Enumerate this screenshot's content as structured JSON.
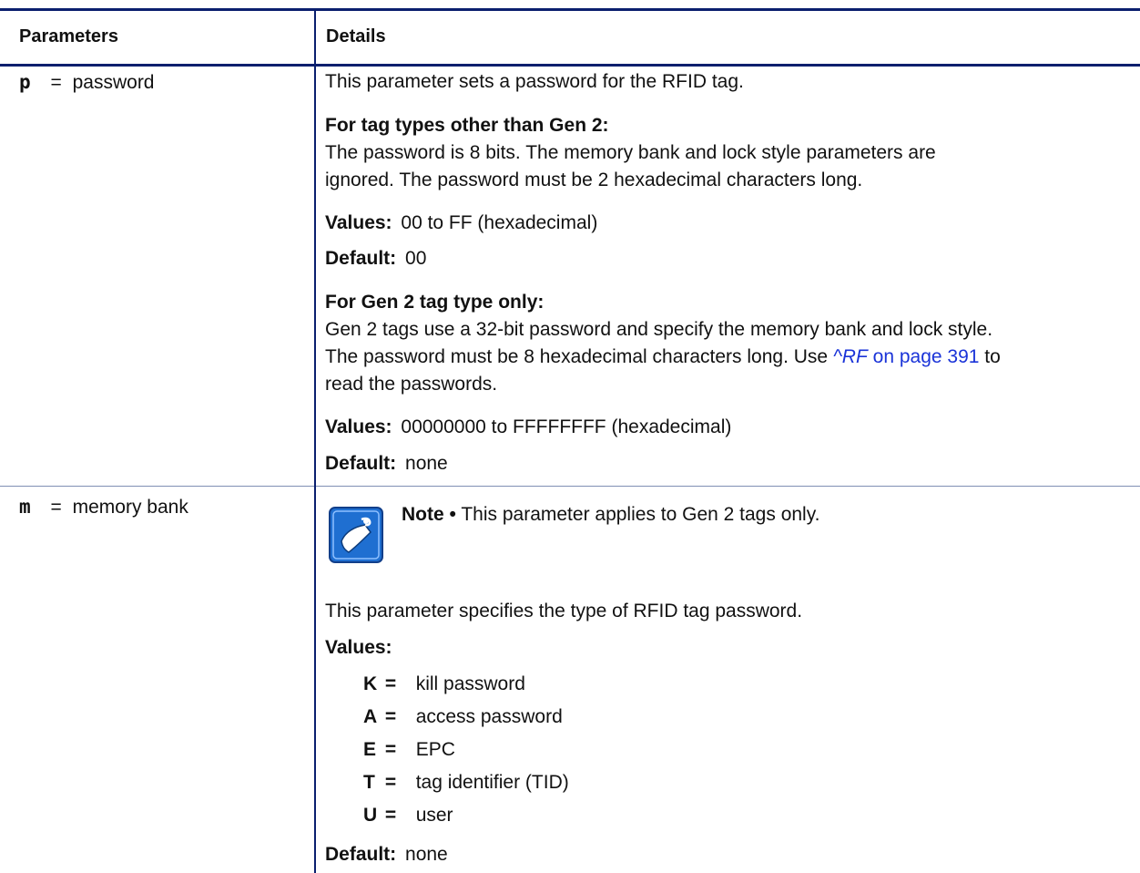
{
  "header": {
    "col1": "Parameters",
    "col2": "Details"
  },
  "row_p": {
    "param_letter": "p",
    "param_eq": "=",
    "param_name": "password",
    "intro": "This parameter sets a password for the RFID tag.",
    "other_heading": "For tag types other than Gen 2:",
    "other_line1": "The password is 8 bits. The memory bank and lock style parameters are",
    "other_line2": "ignored. The password must be 2 hexadecimal characters long.",
    "other_values_label": "Values:",
    "other_values": "00 to FF (hexadecimal)",
    "other_default_label": "Default:",
    "other_default": "00",
    "gen2_heading": "For Gen 2 tag type only:",
    "gen2_line1": "Gen 2 tags use a 32-bit password and specify the memory bank and lock style.",
    "gen2_line2_pre": "The password must be 8 hexadecimal characters long. Use",
    "gen2_link_cmd": "^RF",
    "gen2_link_page": "on page 391",
    "gen2_line2_post": "to",
    "gen2_line3": "read the passwords.",
    "gen2_values_label": "Values:",
    "gen2_values": "00000000 to FFFFFFFF (hexadecimal)",
    "gen2_default_label": "Default:",
    "gen2_default": "none"
  },
  "row_m": {
    "param_letter": "m",
    "param_eq": "=",
    "param_name": "memory bank",
    "note_label": "Note",
    "note_bullet": "•",
    "note_text": "This parameter applies to Gen 2 tags only.",
    "intro": "This parameter specifies the type of RFID tag password.",
    "values_label": "Values:",
    "values": [
      {
        "key": "K",
        "eq": "=",
        "desc": "kill password"
      },
      {
        "key": "A",
        "eq": "=",
        "desc": "access password"
      },
      {
        "key": "E",
        "eq": "=",
        "desc": "EPC"
      },
      {
        "key": "T",
        "eq": "=",
        "desc": "tag identifier (TID)"
      },
      {
        "key": "U",
        "eq": "=",
        "desc": "user"
      }
    ],
    "default_label": "Default:",
    "default": "none"
  },
  "colors": {
    "rule": "#0a1f6e",
    "link": "#1a33d8",
    "note_icon": "#1f6fd1"
  },
  "icons": {
    "note": "note-paper-icon"
  }
}
